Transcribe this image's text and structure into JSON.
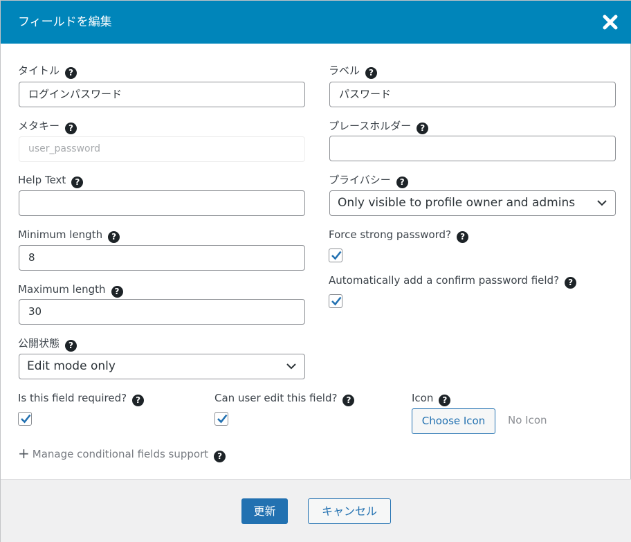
{
  "header": {
    "title": "フィールドを編集",
    "close_icon": "close-icon"
  },
  "help_icon_glyph": "?",
  "fields": {
    "title": {
      "label": "タイトル",
      "value": "ログインパスワード"
    },
    "label": {
      "label": "ラベル",
      "value": "パスワード"
    },
    "meta_key": {
      "label": "メタキー",
      "placeholder": "user_password"
    },
    "placeholder": {
      "label": "プレースホルダー",
      "value": ""
    },
    "help_text": {
      "label": "Help Text",
      "value": ""
    },
    "privacy": {
      "label": "プライバシー",
      "selected": "Only visible to profile owner and admins"
    },
    "min_length": {
      "label": "Minimum length",
      "value": "8"
    },
    "force_strong": {
      "label": "Force strong password?",
      "checked": true
    },
    "max_length": {
      "label": "Maximum length",
      "value": "30"
    },
    "auto_confirm": {
      "label": "Automatically add a confirm password field?",
      "checked": true
    },
    "visibility": {
      "label": "公開状態",
      "selected": "Edit mode only"
    },
    "required": {
      "label": "Is this field required?",
      "checked": true
    },
    "editable": {
      "label": "Can user edit this field?",
      "checked": true
    },
    "icon": {
      "label": "Icon",
      "button_label": "Choose Icon",
      "current": "No Icon"
    }
  },
  "conditional": {
    "plus": "+",
    "label": "Manage conditional fields support"
  },
  "footer": {
    "update_label": "更新",
    "cancel_label": "キャンセル"
  },
  "colors": {
    "header_bg": "#0085ba",
    "primary": "#2271b1",
    "check": "#2271b1",
    "footer_bg": "#f0f0f1"
  }
}
